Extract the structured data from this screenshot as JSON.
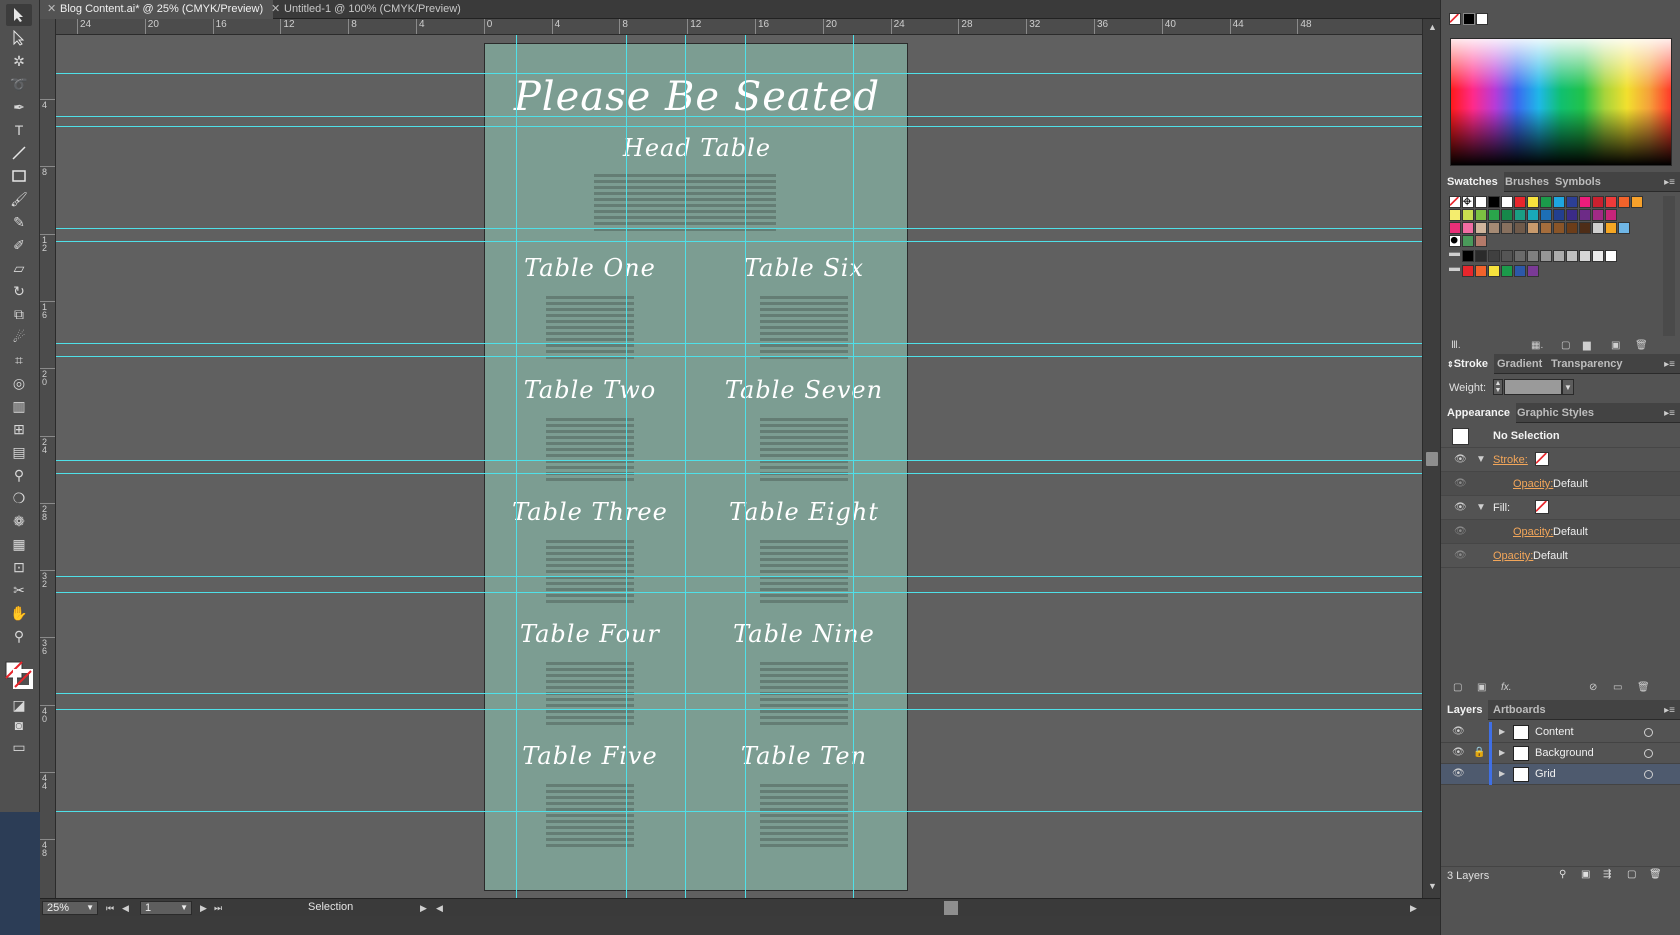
{
  "tabs": [
    {
      "label": "Blog Content.ai* @ 25% (CMYK/Preview)",
      "active": true
    },
    {
      "label": "Untitled-1 @ 100% (CMYK/Preview)",
      "active": false
    }
  ],
  "rulers": {
    "horizontal": [
      "24",
      "20",
      "16",
      "12",
      "8",
      "4",
      "0",
      "4",
      "8",
      "12",
      "16",
      "20",
      "24",
      "28",
      "32",
      "36",
      "40",
      "44",
      "48"
    ],
    "vertical": [
      "4",
      "8",
      "12",
      "16",
      "20",
      "24",
      "28",
      "32",
      "36",
      "40",
      "44",
      "48"
    ]
  },
  "artboard": {
    "title": "Please Be Seated",
    "head_table": "Head Table",
    "tables_left": [
      "Table One",
      "Table Two",
      "Table Three",
      "Table Four",
      "Table Five"
    ],
    "tables_right": [
      "Table Six",
      "Table Seven",
      "Table Eight",
      "Table Nine",
      "Table Ten"
    ],
    "colors": {
      "artboard": "#7c9d92",
      "guides": "#4fe0e8",
      "stripes": "#647d74"
    }
  },
  "statusbar": {
    "zoom": "25%",
    "page": "1",
    "tool": "Selection"
  },
  "panels": {
    "swatches_tabs": [
      "Swatches",
      "Brushes",
      "Symbols"
    ],
    "stroke_tabs": [
      "Stroke",
      "Gradient",
      "Transparency"
    ],
    "stroke": {
      "weight_label": "Weight:",
      "weight_value": ""
    },
    "appearance_tabs": [
      "Appearance",
      "Graphic Styles"
    ],
    "appearance": {
      "selection": "No Selection",
      "stroke_label": "Stroke:",
      "fill_label": "Fill:",
      "opacity_label": "Opacity:",
      "opacity_value": "Default"
    },
    "layers_tabs": [
      "Layers",
      "Artboards"
    ],
    "layers": [
      {
        "name": "Content",
        "locked": false,
        "selected": false
      },
      {
        "name": "Background",
        "locked": true,
        "selected": false
      },
      {
        "name": "Grid",
        "locked": false,
        "selected": true
      }
    ],
    "layers_count": "3 Layers"
  },
  "swatch_colors": {
    "row1": [
      "#ffffff",
      "#000000",
      "#ffffff",
      "#e8262c",
      "#f7e33d",
      "#1b9a4a",
      "#1ea6e0",
      "#2c3f95",
      "#ec1d7b",
      "#c9202f",
      "#ee3a3a",
      "#f2632b",
      "#f7a12b"
    ],
    "row2": [
      "#f4ed6e",
      "#c8dc4f",
      "#7cc142",
      "#2aa54b",
      "#16884a",
      "#1a9e83",
      "#19a9b9",
      "#1d6fb6",
      "#223f8f",
      "#3b2b88",
      "#6d2b87",
      "#a02a85",
      "#c7247a"
    ],
    "row3": [
      "#ea2f78",
      "#f06da2",
      "#d1b59c",
      "#a58a74",
      "#87705e",
      "#6f5a4a",
      "#c89a6c",
      "#a56d3c",
      "#8a5528",
      "#6c3d19",
      "#4e2d17",
      "#cfcfcf",
      "#f5a623",
      "#6fb6e6"
    ],
    "row4": [
      "#000000",
      "#2b2b2b",
      "#404040",
      "#555555",
      "#6b6b6b",
      "#808080",
      "#969696",
      "#ababab",
      "#c0c0c0",
      "#d6d6d6",
      "#ebebeb",
      "#ffffff"
    ],
    "row5": [
      "#e8262c",
      "#f2632b",
      "#f7e33d",
      "#1b9a4a",
      "#2c58a8",
      "#7a3a96"
    ]
  }
}
